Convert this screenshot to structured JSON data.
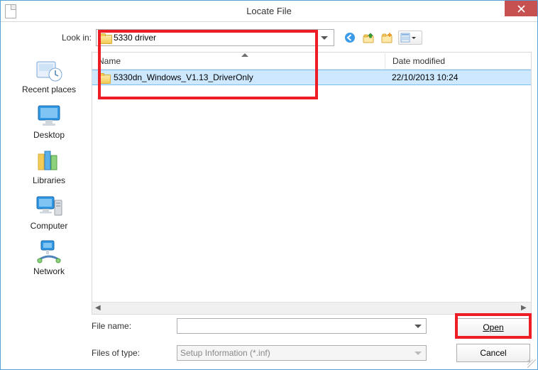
{
  "window": {
    "title": "Locate File"
  },
  "lookin": {
    "label": "Look in:",
    "value": "5330 driver"
  },
  "toolbar_icons": [
    "back-icon",
    "up-icon",
    "new-folder-icon",
    "views-icon"
  ],
  "columns": {
    "name": "Name",
    "date": "Date modified"
  },
  "files": [
    {
      "name": "5330dn_Windows_V1.13_DriverOnly",
      "date": "22/10/2013 10:24",
      "selected": true
    }
  ],
  "places": [
    {
      "id": "recent",
      "label": "Recent places"
    },
    {
      "id": "desktop",
      "label": "Desktop"
    },
    {
      "id": "libraries",
      "label": "Libraries"
    },
    {
      "id": "computer",
      "label": "Computer"
    },
    {
      "id": "network",
      "label": "Network"
    }
  ],
  "filename": {
    "label": "File name:",
    "value": ""
  },
  "filetype": {
    "label": "Files of type:",
    "value": "Setup Information (*.inf)"
  },
  "buttons": {
    "open": "Open",
    "cancel": "Cancel"
  }
}
